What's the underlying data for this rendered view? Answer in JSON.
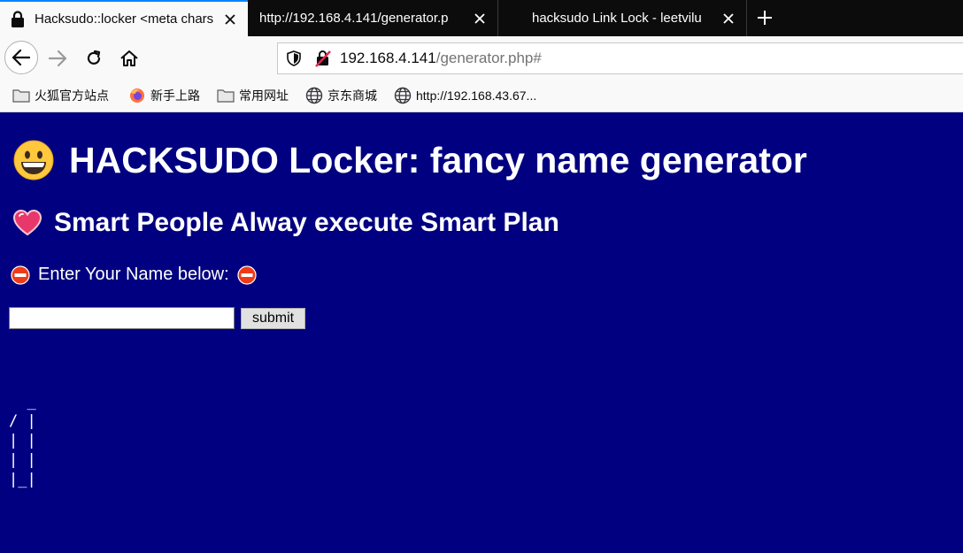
{
  "browser": {
    "tabs": [
      {
        "title": "Hacksudo::locker <meta chars",
        "active": true
      },
      {
        "title": "http://192.168.4.141/generator.p",
        "active": false
      },
      {
        "title": "hacksudo Link Lock - leetvilu",
        "active": false
      }
    ],
    "url": {
      "host": "192.168.4.141",
      "path": "/generator.php#"
    },
    "bookmarks": [
      {
        "label": "火狐官方站点",
        "icon": "folder-icon"
      },
      {
        "label": "新手上路",
        "icon": "firefox-icon"
      },
      {
        "label": "常用网址",
        "icon": "folder-icon"
      },
      {
        "label": "京东商城",
        "icon": "globe-icon"
      },
      {
        "label": "http://192.168.43.67...",
        "icon": "globe-icon"
      }
    ]
  },
  "page": {
    "heading_emoji": "😀",
    "heading": "HACKSUDO Locker: fancy name generator",
    "subheading_emoji": "💗",
    "subheading": "Smart People Alway execute Smart Plan",
    "prompt": "Enter Your Name below:",
    "prompt_icon": "no-entry-icon",
    "name_value": "",
    "submit_label": "submit",
    "ascii_art": "  _\n/ |\n| |\n| |\n|_|"
  },
  "colors": {
    "page_background": "#000080",
    "tab_accent": "#0a84ff",
    "tabstrip": "#0c0c0d"
  }
}
